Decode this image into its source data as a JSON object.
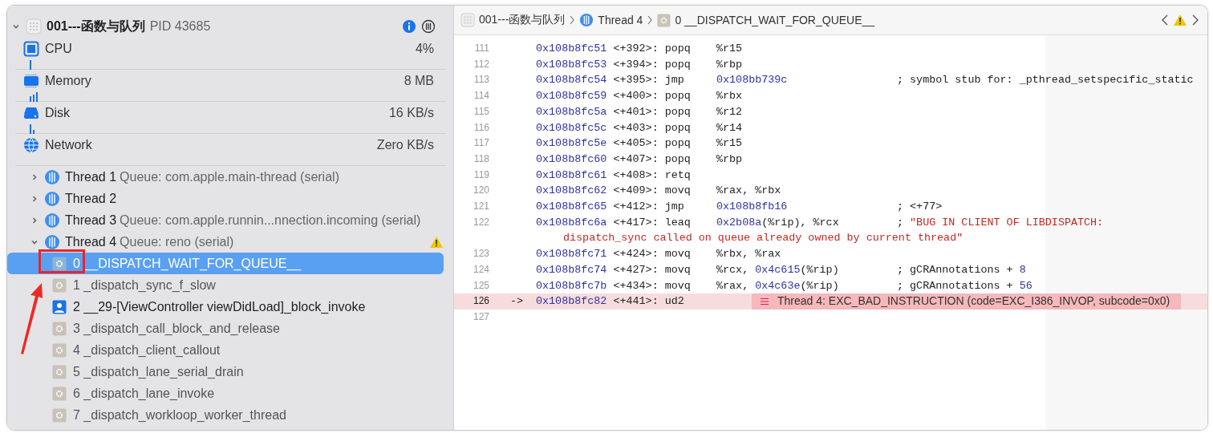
{
  "process": {
    "name": "001---函数与队列",
    "pid": "PID 43685",
    "expanded": true
  },
  "gauges": [
    {
      "kind": "cpu",
      "label": "CPU",
      "value": "4%"
    },
    {
      "kind": "memory",
      "label": "Memory",
      "value": "8 MB"
    },
    {
      "kind": "disk",
      "label": "Disk",
      "value": "16 KB/s"
    },
    {
      "kind": "network",
      "label": "Network",
      "value": "Zero KB/s"
    }
  ],
  "threads": [
    {
      "name": "Thread 1",
      "queue": "Queue: com.apple.main-thread (serial)",
      "expanded": false,
      "warning": false
    },
    {
      "name": "Thread 2",
      "expanded": false,
      "warning": false
    },
    {
      "name": "Thread 3",
      "queue": "Queue: com.apple.runnin...nnection.incoming (serial)",
      "expanded": false,
      "warning": false
    },
    {
      "name": "Thread 4",
      "queue": "Queue: reno (serial)",
      "expanded": true,
      "warning": true,
      "children": [
        {
          "label": "0 __DISPATCH_WAIT_FOR_QUEUE__",
          "kind": "system",
          "selected": true
        },
        {
          "label": "1 _dispatch_sync_f_slow",
          "kind": "system",
          "selected": false
        },
        {
          "label": "2 __29-[ViewController viewDidLoad]_block_invoke",
          "kind": "user",
          "selected": false
        },
        {
          "label": "3 _dispatch_call_block_and_release",
          "kind": "system",
          "selected": false
        },
        {
          "label": "4 _dispatch_client_callout",
          "kind": "system",
          "selected": false
        },
        {
          "label": "5 _dispatch_lane_serial_drain",
          "kind": "system",
          "selected": false
        },
        {
          "label": "6 _dispatch_lane_invoke",
          "kind": "system",
          "selected": false
        },
        {
          "label": "7 _dispatch_workloop_worker_thread",
          "kind": "system",
          "selected": false
        }
      ]
    }
  ],
  "breadcrumb": [
    {
      "kind": "app",
      "label": "001---函数与队列"
    },
    {
      "kind": "thread",
      "label": "Thread 4"
    },
    {
      "kind": "frame",
      "label": "0 __DISPATCH_WAIT_FOR_QUEUE__"
    }
  ],
  "editor": {
    "warning": true,
    "lines": [
      {
        "num": "111",
        "current": false,
        "addr": "0x108b8fc51",
        "offset": "<+392>:",
        "op": "popq",
        "args": [
          {
            "t": "%r15",
            "kind": "plain"
          }
        ]
      },
      {
        "num": "112",
        "current": false,
        "addr": "0x108b8fc53",
        "offset": "<+394>:",
        "op": "popq",
        "args": [
          {
            "t": "%rbp",
            "kind": "plain"
          }
        ]
      },
      {
        "num": "113",
        "current": false,
        "addr": "0x108b8fc54",
        "offset": "<+395>:",
        "op": "jmp",
        "args": [
          {
            "t": "0x108bb739c",
            "kind": "number"
          }
        ],
        "comment": [
          {
            "t": "; symbol stub for: _pthread_setspecific_static",
            "kind": "plain"
          }
        ]
      },
      {
        "num": "114",
        "current": false,
        "addr": "0x108b8fc59",
        "offset": "<+400>:",
        "op": "popq",
        "args": [
          {
            "t": "%rbx",
            "kind": "plain"
          }
        ]
      },
      {
        "num": "115",
        "current": false,
        "addr": "0x108b8fc5a",
        "offset": "<+401>:",
        "op": "popq",
        "args": [
          {
            "t": "%r12",
            "kind": "plain"
          }
        ]
      },
      {
        "num": "116",
        "current": false,
        "addr": "0x108b8fc5c",
        "offset": "<+403>:",
        "op": "popq",
        "args": [
          {
            "t": "%r14",
            "kind": "plain"
          }
        ]
      },
      {
        "num": "117",
        "current": false,
        "addr": "0x108b8fc5e",
        "offset": "<+405>:",
        "op": "popq",
        "args": [
          {
            "t": "%r15",
            "kind": "plain"
          }
        ]
      },
      {
        "num": "118",
        "current": false,
        "addr": "0x108b8fc60",
        "offset": "<+407>:",
        "op": "popq",
        "args": [
          {
            "t": "%rbp",
            "kind": "plain"
          }
        ]
      },
      {
        "num": "119",
        "current": false,
        "addr": "0x108b8fc61",
        "offset": "<+408>:",
        "op": "retq"
      },
      {
        "num": "120",
        "current": false,
        "addr": "0x108b8fc62",
        "offset": "<+409>:",
        "op": "movq",
        "args": [
          {
            "t": "%rax, %rbx",
            "kind": "plain"
          }
        ]
      },
      {
        "num": "121",
        "current": false,
        "addr": "0x108b8fc65",
        "offset": "<+412>:",
        "op": "jmp",
        "args": [
          {
            "t": "0x108b8fb16",
            "kind": "number"
          }
        ],
        "comment": [
          {
            "t": "; <+77>",
            "kind": "plain"
          }
        ]
      },
      {
        "num": "122",
        "current": false,
        "addr": "0x108b8fc6a",
        "offset": "<+417>:",
        "op": "leaq",
        "args": [
          {
            "t": "0x2b08a",
            "kind": "number"
          },
          {
            "t": "(%rip), %rcx",
            "kind": "plain"
          }
        ],
        "comment": [
          {
            "t": "; ",
            "kind": "plain"
          },
          {
            "t": "\"BUG IN CLIENT OF LIBDISPATCH:",
            "kind": "string"
          }
        ],
        "continuation": "dispatch_sync called on queue already owned by current thread\""
      },
      {
        "num": "123",
        "current": false,
        "addr": "0x108b8fc71",
        "offset": "<+424>:",
        "op": "movq",
        "args": [
          {
            "t": "%rbx, %rax",
            "kind": "plain"
          }
        ]
      },
      {
        "num": "124",
        "current": false,
        "addr": "0x108b8fc74",
        "offset": "<+427>:",
        "op": "movq",
        "args": [
          {
            "t": "%rcx, ",
            "kind": "plain"
          },
          {
            "t": "0x4c615",
            "kind": "number"
          },
          {
            "t": "(%rip)",
            "kind": "plain"
          }
        ],
        "comment": [
          {
            "t": "; gCRAnnotations + ",
            "kind": "plain"
          },
          {
            "t": "8",
            "kind": "number"
          }
        ]
      },
      {
        "num": "125",
        "current": false,
        "addr": "0x108b8fc7b",
        "offset": "<+434>:",
        "op": "movq",
        "args": [
          {
            "t": "%rax, ",
            "kind": "plain"
          },
          {
            "t": "0x4c63e",
            "kind": "number"
          },
          {
            "t": "(%rip)",
            "kind": "plain"
          }
        ],
        "comment": [
          {
            "t": "; gCRAnnotations + ",
            "kind": "plain"
          },
          {
            "t": "56",
            "kind": "number"
          }
        ]
      },
      {
        "num": "126",
        "current": true,
        "marker": "->",
        "addr": "0x108b8fc82",
        "offset": "<+441>:",
        "op": "ud2",
        "error": "Thread 4: EXC_BAD_INSTRUCTION (code=EXC_I386_INVOP, subcode=0x0)"
      },
      {
        "num": "127",
        "current": false
      }
    ]
  }
}
